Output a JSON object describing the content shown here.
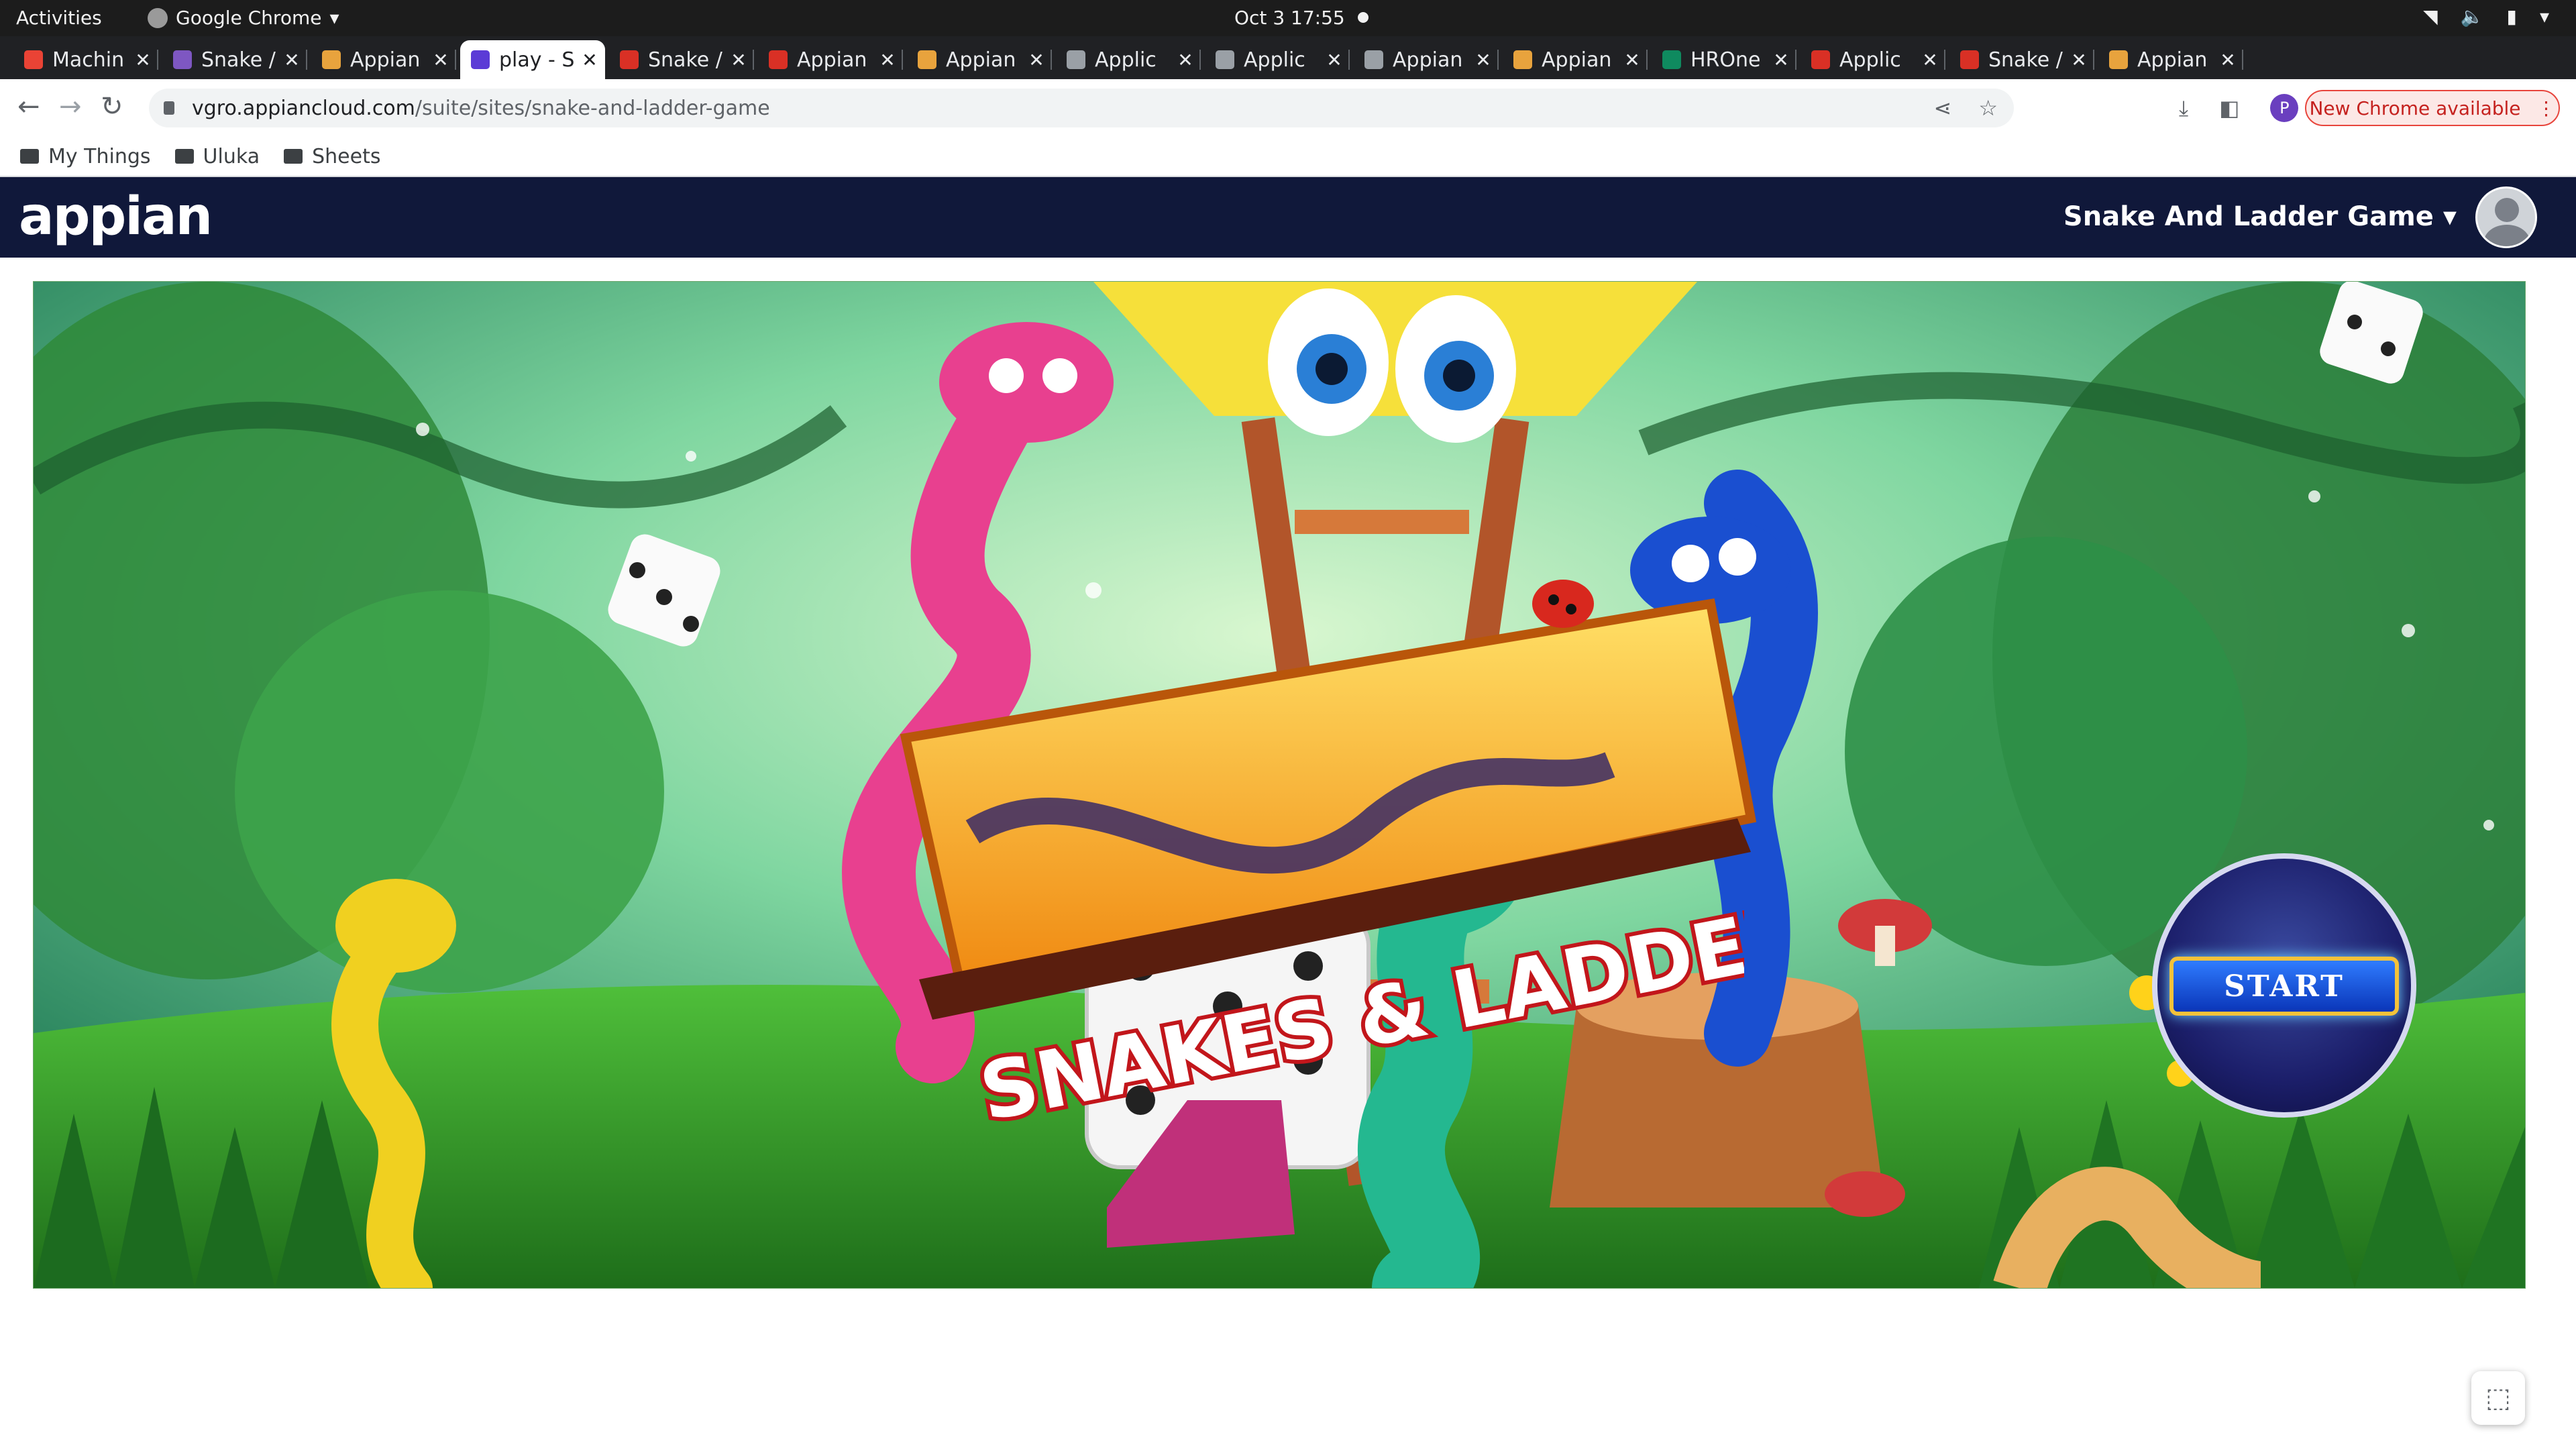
{
  "system": {
    "activities": "Activities",
    "app": "Google Chrome",
    "clock": "Oct 3  17:55"
  },
  "tabs": [
    {
      "label": "Machin",
      "fav": "gmail",
      "color": "#ea4335"
    },
    {
      "label": "Snake /",
      "fav": "grid",
      "color": "#7e57c2"
    },
    {
      "label": "Appian",
      "fav": "appian-a",
      "color": "#e8a33d"
    },
    {
      "label": "play - S",
      "fav": "appian-play",
      "color": "#5b3bd6"
    },
    {
      "label": "Snake /",
      "fav": "appian-red",
      "color": "#d93025"
    },
    {
      "label": "Appian",
      "fav": "appian-red",
      "color": "#d93025"
    },
    {
      "label": "Appian",
      "fav": "appian-a",
      "color": "#e8a33d"
    },
    {
      "label": "Applic",
      "fav": "page",
      "color": "#9aa0a6"
    },
    {
      "label": "Applic",
      "fav": "page",
      "color": "#9aa0a6"
    },
    {
      "label": "Appian",
      "fav": "page",
      "color": "#9aa0a6"
    },
    {
      "label": "Appian",
      "fav": "appian-a",
      "color": "#e8a33d"
    },
    {
      "label": "HROne",
      "fav": "hrone",
      "color": "#0f8a5f"
    },
    {
      "label": "Applic",
      "fav": "appian-red",
      "color": "#d93025"
    },
    {
      "label": "Snake /",
      "fav": "appian-red",
      "color": "#d93025"
    },
    {
      "label": "Appian",
      "fav": "appian-a",
      "color": "#e8a33d"
    }
  ],
  "address": {
    "host": "vgro.appiancloud.com",
    "path": "/suite/sites/snake-and-ladder-game"
  },
  "new_chrome": "New Chrome available",
  "bookmarks": [
    "My Things",
    "Uluka",
    "Sheets"
  ],
  "appbar": {
    "logo": "appian",
    "site_name": "Snake And Ladder Game"
  },
  "game": {
    "title": "SNAKES & LADDERS",
    "start_label": "START"
  }
}
